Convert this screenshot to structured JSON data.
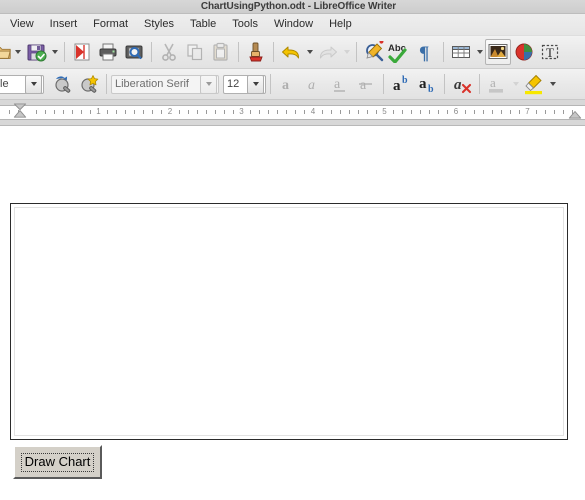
{
  "window": {
    "title": "ChartUsingPython.odt - LibreOffice Writer"
  },
  "menubar": {
    "items": [
      {
        "label": "View"
      },
      {
        "label": "Insert"
      },
      {
        "label": "Format"
      },
      {
        "label": "Styles"
      },
      {
        "label": "Table"
      },
      {
        "label": "Tools"
      },
      {
        "label": "Window"
      },
      {
        "label": "Help"
      }
    ]
  },
  "standard_toolbar": {
    "items": [
      {
        "name": "open-icon",
        "label": "Open"
      },
      {
        "name": "open-dropdown-icon",
        "label": "Open Dropdown"
      },
      {
        "name": "save-icon",
        "label": "Save"
      },
      {
        "name": "save-dropdown-icon",
        "label": "Save Dropdown"
      },
      {
        "name": "export-pdf-icon",
        "label": "Export as PDF"
      },
      {
        "name": "print-icon",
        "label": "Print"
      },
      {
        "name": "print-preview-icon",
        "label": "Toggle Print Preview"
      },
      {
        "name": "cut-icon",
        "label": "Cut"
      },
      {
        "name": "copy-icon",
        "label": "Copy"
      },
      {
        "name": "paste-icon",
        "label": "Paste"
      },
      {
        "name": "clone-formatting-icon",
        "label": "Clone Formatting"
      },
      {
        "name": "undo-icon",
        "label": "Undo"
      },
      {
        "name": "undo-dropdown-icon",
        "label": "Undo Dropdown"
      },
      {
        "name": "redo-icon",
        "label": "Redo"
      },
      {
        "name": "redo-dropdown-icon",
        "label": "Redo Dropdown"
      },
      {
        "name": "find-replace-icon",
        "label": "Find and Replace"
      },
      {
        "name": "spelling-icon",
        "label": "Check Spelling"
      },
      {
        "name": "formatting-marks-icon",
        "label": "Formatting Marks"
      },
      {
        "name": "insert-table-icon",
        "label": "Insert Table"
      },
      {
        "name": "insert-table-dropdown-icon",
        "label": "Insert Table Dropdown"
      },
      {
        "name": "insert-image-icon",
        "label": "Insert Image"
      },
      {
        "name": "insert-chart-icon",
        "label": "Insert Chart"
      },
      {
        "name": "insert-text-box-icon",
        "label": "Insert Text Box"
      }
    ]
  },
  "formatting_toolbar": {
    "paragraph_style": {
      "value": "le",
      "full_value": "Default Paragraph Style"
    },
    "update_style_label": "Update Selected Style",
    "new_style_label": "New Style from Selection",
    "font_name": {
      "value": "Liberation Serif"
    },
    "font_size": {
      "value": "12"
    },
    "items": [
      {
        "name": "bold-icon",
        "label": "Bold"
      },
      {
        "name": "italic-icon",
        "label": "Italic"
      },
      {
        "name": "underline-icon",
        "label": "Underline"
      },
      {
        "name": "strikethrough-icon",
        "label": "Strikethrough"
      },
      {
        "name": "superscript-icon",
        "label": "Superscript"
      },
      {
        "name": "subscript-icon",
        "label": "Subscript"
      },
      {
        "name": "clear-formatting-icon",
        "label": "Clear Direct Formatting"
      },
      {
        "name": "font-color-icon",
        "label": "Font Color"
      },
      {
        "name": "highlighting-color-icon",
        "label": "Highlighting Color"
      }
    ]
  },
  "ruler": {
    "unit": "inch",
    "numbers": [
      "1",
      "2",
      "3",
      "4",
      "5",
      "6",
      "7"
    ],
    "left_indent_label": "Left Indent Marker",
    "right_indent_label": "Right Indent Marker"
  },
  "document": {
    "form_frame_label": "Form Container",
    "draw_chart_button": {
      "label": "Draw Chart"
    }
  },
  "colors": {
    "titlebar_bg": "#d2d2d2",
    "toolbar_bg": "#e8e8e8",
    "doc_bg": "#ffffff",
    "button_face": "#d4d0c8",
    "frame_border": "#2b2b2b",
    "accent_yellow": "#f5c400",
    "accent_red": "#d43a2f"
  }
}
